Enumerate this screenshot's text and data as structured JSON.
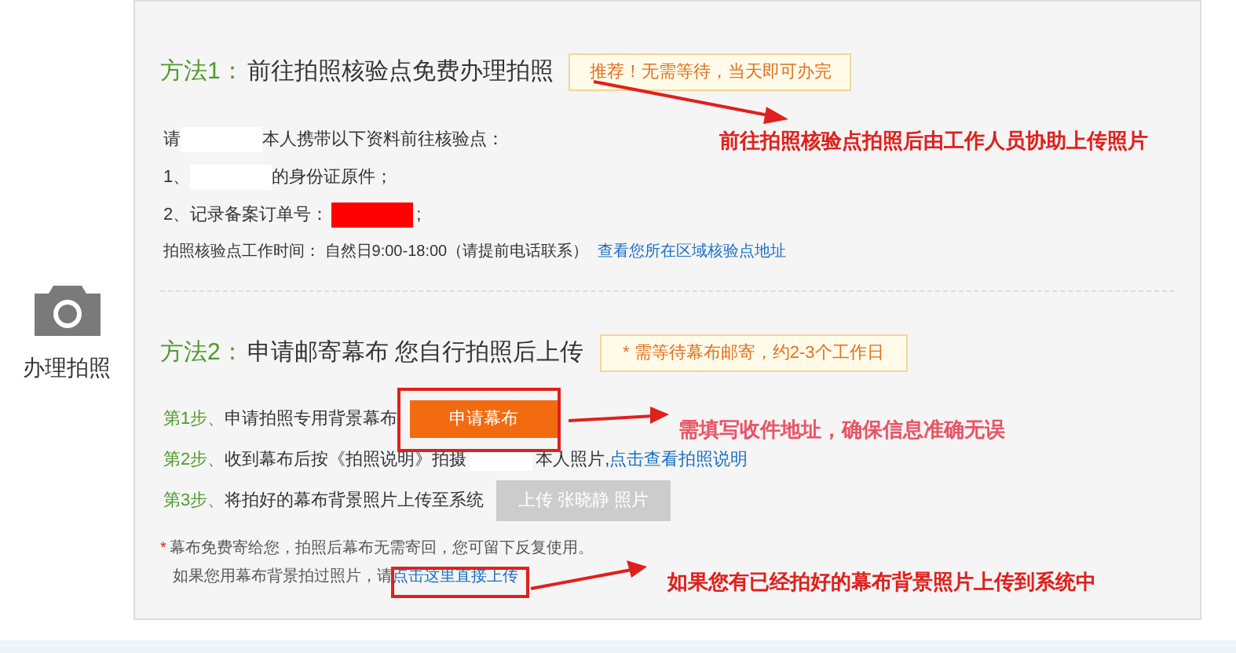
{
  "sidebar": {
    "label": "办理拍照"
  },
  "method1": {
    "prefix": "方法1：",
    "title": "前往拍照核验点免费办理拍照",
    "tag": "推荐！无需等待，当天即可办完",
    "lines": [
      {
        "parts": [
          {
            "kind": "text",
            "text": "请"
          },
          {
            "kind": "blank"
          },
          {
            "kind": "text",
            "text": "本人携带以下资料前往核验点："
          }
        ]
      },
      {
        "parts": [
          {
            "kind": "text",
            "text": "1、"
          },
          {
            "kind": "blank"
          },
          {
            "kind": "text",
            "text": "的身份证原件；"
          }
        ]
      },
      {
        "parts": [
          {
            "kind": "text",
            "text": "2、记录备案订单号："
          },
          {
            "kind": "redacted"
          },
          {
            "kind": "text",
            "text": ";"
          }
        ]
      }
    ],
    "hours": "拍照核验点工作时间： 自然日9:00-18:00（请提前电话联系）",
    "hours_link": "查看您所在区域核验点地址"
  },
  "method2": {
    "prefix": "方法2：",
    "title": "申请邮寄幕布 您自行拍照后上传",
    "tag": "* 需等待幕布邮寄，约2-3个工作日",
    "steps": [
      {
        "step": "第1步、",
        "kind": "action",
        "text": "申请拍照专用背景幕布",
        "button": "申请幕布",
        "disabled": false
      },
      {
        "step": "第2步、",
        "kind": "link",
        "text": "收到幕布后按《拍照说明》拍摄",
        "blank": true,
        "text_after": "本人照片,",
        "link": "点击查看拍照说明"
      },
      {
        "step": "第3步、",
        "kind": "action",
        "text": "将拍好的幕布背景照片上传至系统",
        "button": "上传 张晓静 照片",
        "disabled": true
      }
    ],
    "note_mark": "*",
    "note": "幕布免费寄给您，拍照后幕布无需寄回，您可留下反复使用。",
    "note2": "如果您用幕布背景拍过照片，请",
    "note2_link": "点击这里直接上传"
  },
  "annotations": [
    {
      "text": "前往拍照核验点拍照后由工作人员协助上传照片",
      "color": "#e0201c"
    },
    {
      "text": "需填写收件地址，确保信息准确无误",
      "color": "#ea5466"
    },
    {
      "text": "如果您有已经拍好的幕布背景照片上传到系统中",
      "color": "#e0201c"
    }
  ]
}
